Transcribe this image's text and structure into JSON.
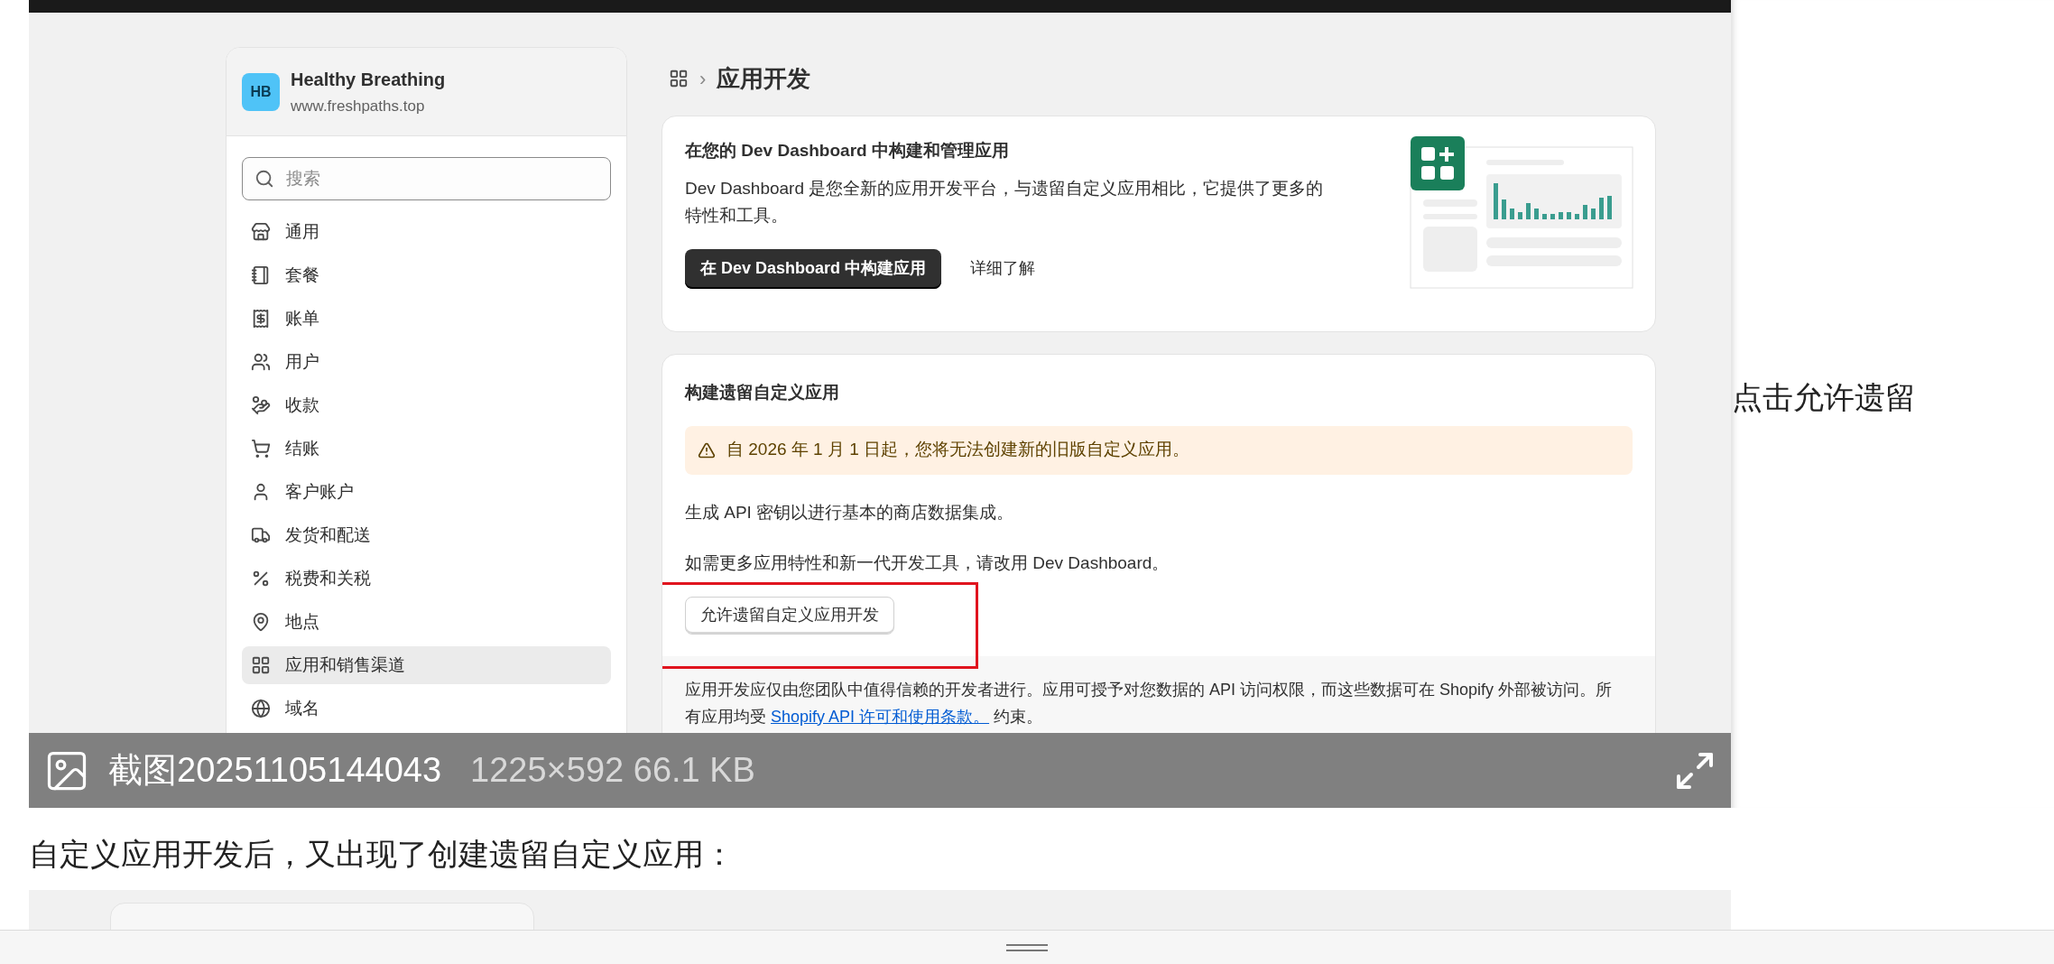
{
  "shop": {
    "initials": "HB",
    "name": "Healthy Breathing",
    "domain": "www.freshpaths.top"
  },
  "search": {
    "placeholder": "搜索"
  },
  "sidebar": {
    "items": [
      {
        "label": "通用",
        "selected": false
      },
      {
        "label": "套餐",
        "selected": false
      },
      {
        "label": "账单",
        "selected": false
      },
      {
        "label": "用户",
        "selected": false
      },
      {
        "label": "收款",
        "selected": false
      },
      {
        "label": "结账",
        "selected": false
      },
      {
        "label": "客户账户",
        "selected": false
      },
      {
        "label": "发货和配送",
        "selected": false
      },
      {
        "label": "税费和关税",
        "selected": false
      },
      {
        "label": "地点",
        "selected": false
      },
      {
        "label": "应用和销售渠道",
        "selected": true
      },
      {
        "label": "域名",
        "selected": false
      }
    ]
  },
  "breadcrumb": {
    "separator": "›",
    "title": "应用开发"
  },
  "dev_card": {
    "title": "在您的 Dev Dashboard 中构建和管理应用",
    "description": "Dev Dashboard 是您全新的应用开发平台，与遗留自定义应用相比，它提供了更多的特性和工具。",
    "primary_button": "在 Dev Dashboard 中构建应用",
    "link": "详细了解"
  },
  "legacy_card": {
    "title": "构建遗留自定义应用",
    "warning": "自 2026 年 1 月 1 日起，您将无法创建新的旧版自定义应用。",
    "paragraphs": [
      "生成 API 密钥以进行基本的商店数据集成。",
      "如需更多应用特性和新一代开发工具，请改用 Dev Dashboard。"
    ],
    "button": "允许遗留自定义应用开发",
    "footer_before": "应用开发应仅由您团队中值得信赖的开发者进行。应用可授予对您数据的 API 访问权限，而这些数据可在 Shopify 外部被访问。所有应用均受 ",
    "footer_link": "Shopify API 许可和使用条款。",
    "footer_after": " 约束。"
  },
  "image_info": {
    "filename": "截图20251105144043",
    "meta": "1225×592 66.1 KB"
  },
  "side_note": "点击允许遗留",
  "caption": "自定义应用开发后，又出现了创建遗留自定义应用："
}
